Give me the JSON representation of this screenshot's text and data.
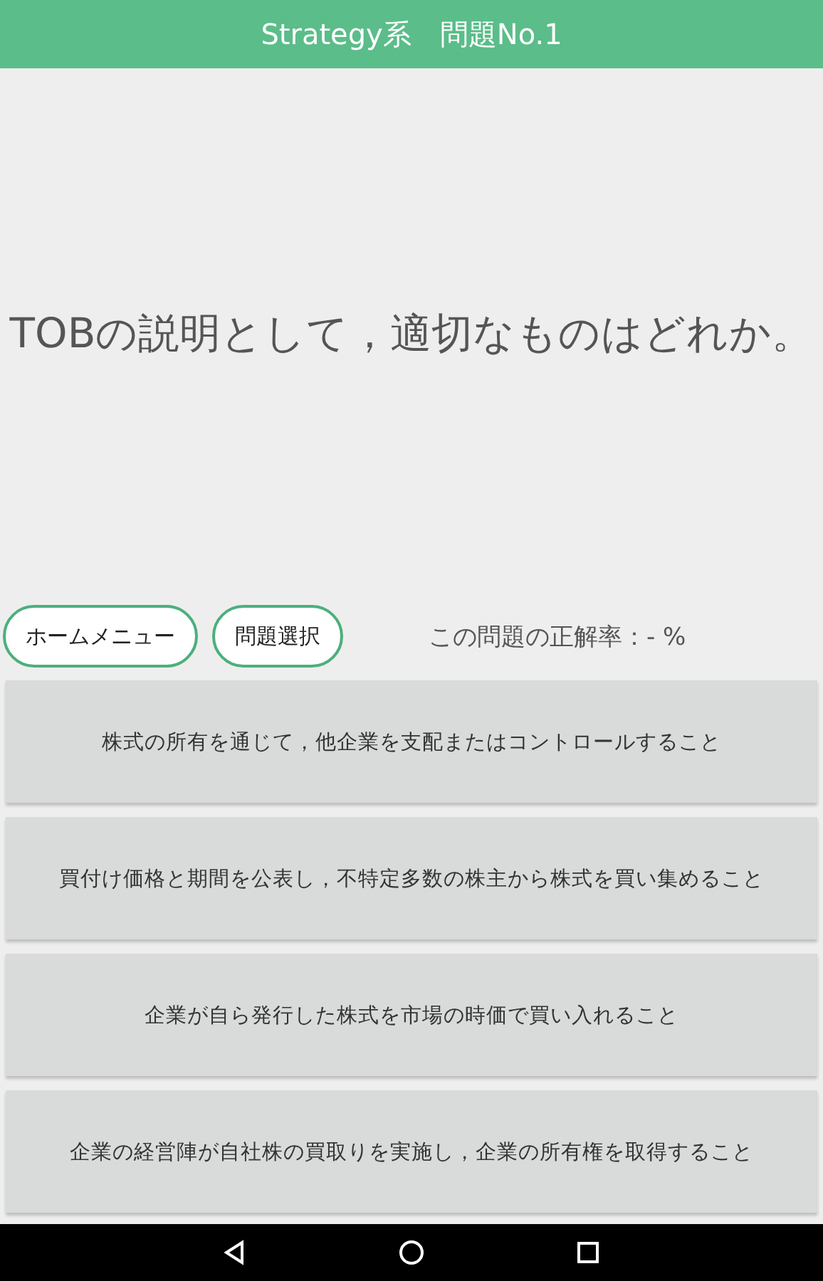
{
  "header": {
    "title": "Strategy系　問題No.1"
  },
  "question": "TOBの説明として，適切なものはどれか。",
  "buttons": [
    "ホームメニュー",
    "問題選択"
  ],
  "accuracy": "この問題の正解率：- %",
  "answers": [
    "株式の所有を通じて，他企業を支配またはコントロールすること",
    "買付け価格と期間を公表し，不特定多数の株主から株式を買い集めること",
    "企業が自ら発行した株式を市場の時価で買い入れること",
    "企業の経営陣が自社株の買取りを実施し，企業の所有権を取得すること"
  ]
}
